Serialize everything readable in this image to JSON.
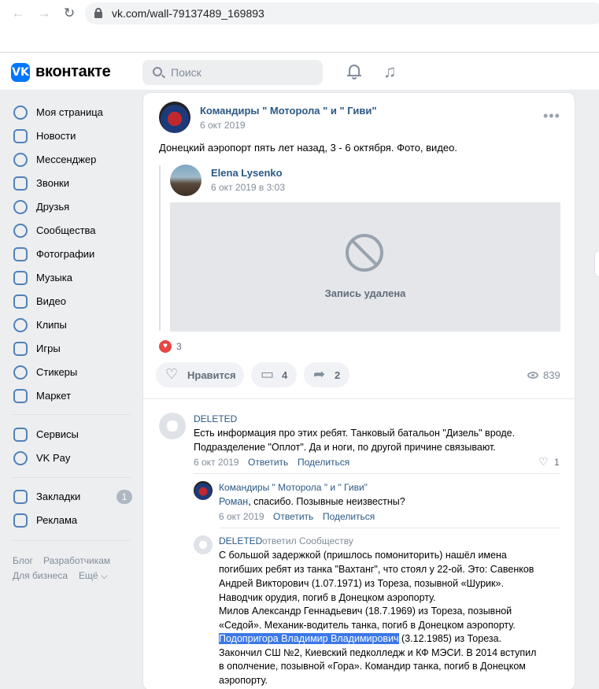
{
  "browser": {
    "url": "vk.com/wall-79137489_169893"
  },
  "header": {
    "logo": "VK",
    "brand": "вконтакте",
    "search_placeholder": "Поиск"
  },
  "menu": {
    "items": [
      {
        "label": "Моя страница",
        "icon": "user-icon"
      },
      {
        "label": "Новости",
        "icon": "news-icon"
      },
      {
        "label": "Мессенджер",
        "icon": "message-icon"
      },
      {
        "label": "Звонки",
        "icon": "phone-icon"
      },
      {
        "label": "Друзья",
        "icon": "friends-icon"
      },
      {
        "label": "Сообщества",
        "icon": "groups-icon"
      },
      {
        "label": "Фотографии",
        "icon": "photo-icon"
      },
      {
        "label": "Музыка",
        "icon": "music-icon"
      },
      {
        "label": "Видео",
        "icon": "video-icon"
      },
      {
        "label": "Клипы",
        "icon": "clips-icon"
      },
      {
        "label": "Игры",
        "icon": "games-icon"
      },
      {
        "label": "Стикеры",
        "icon": "sticker-icon"
      },
      {
        "label": "Маркет",
        "icon": "market-icon"
      }
    ],
    "items2": [
      {
        "label": "Сервисы",
        "icon": "services-icon"
      },
      {
        "label": "VK Pay",
        "icon": "vkpay-icon"
      }
    ],
    "items3": [
      {
        "label": "Закладки",
        "icon": "bookmark-icon",
        "badge": "1"
      },
      {
        "label": "Реклама",
        "icon": "ads-icon"
      }
    ],
    "footer": {
      "blog": "Блог",
      "devs": "Разработчикам",
      "business": "Для бизнеса",
      "more": "Ещё ⌵"
    }
  },
  "post": {
    "author": "Командиры \" Моторола \" и \" Гиви\"",
    "date": "6 окт 2019",
    "text": "Донецкий аэропорт пять лет назад, 3 - 6 октября. Фото, видео.",
    "repost": {
      "author": "Elena Lysenko",
      "date": "6 окт 2019 в 3:03",
      "deleted_text": "Запись удалена"
    },
    "reactions_count": "3",
    "like_label": "Нравится",
    "comments_count": "4",
    "shares_count": "2",
    "views": "839"
  },
  "comments": [
    {
      "author": "DELETED",
      "lines": [
        "Есть информация про этих ребят. Танковый батальон \"Дизель\" вроде.",
        "Подразделение \"Оплот\". Да и ноги, по другой причине связывают."
      ],
      "date": "6 окт 2019",
      "reply": "Ответить",
      "share": "Поделиться",
      "likes": "1"
    },
    {
      "author": "Командиры \" Моторола \" и \" Гиви\"",
      "mention": "Роман",
      "text": ", спасибо. Позывные неизвестны?",
      "date": "6 окт 2019",
      "reply": "Ответить",
      "share": "Поделиться"
    },
    {
      "author": "DELETED",
      "replied_to": "ответил Сообществу",
      "lines": [
        "С большой задержкой (пришлось помониторить) нашёл имена",
        "погибших ребят из танка \"Вахтанг\", что стоял у 22-ой. Это: Савенков",
        "Андрей Викторович (1.07.1971) из Тореза, позывной «Шурик».",
        "Наводчик орудия, погиб в Донецком аэропорту.",
        "Милов Александр Геннадьевич (18.7.1969) из Тореза, позывной",
        "«Седой». Механик-водитель танка, погиб в Донецком аэропорту."
      ],
      "highlighted": "Подопригора Владимир Владимирович",
      "after_highlight": " (3.12.1985) из Тореза.",
      "lines2": [
        "Закончил СШ №2, Киевский педколледж и КФ МЭСИ. В 2014 вступил",
        "в ополчение, позывной «Гора». Командир танка, погиб в Донецком",
        "аэропорту."
      ]
    }
  ]
}
